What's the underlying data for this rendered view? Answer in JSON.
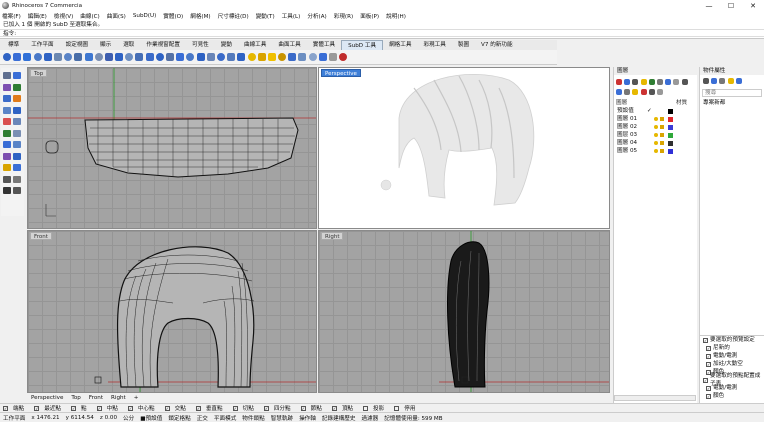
{
  "window": {
    "title": "Rhinoceros 7 Commercia",
    "buttons": [
      "—",
      "☐",
      "✕"
    ]
  },
  "menu": [
    "檔案(F)",
    "編輯(E)",
    "檢視(V)",
    "曲線(C)",
    "曲面(S)",
    "SubD(U)",
    "實體(O)",
    "網格(M)",
    "尺寸標註(D)",
    "變動(T)",
    "工具(L)",
    "分析(A)",
    "彩現(R)",
    "面板(P)",
    "說明(H)"
  ],
  "command": {
    "history1": "已加入 1 個 開啟的 SubD 至選取集合。",
    "history2": "指令:",
    "prompt": ""
  },
  "tabs": [
    "標準",
    "工作平面",
    "設定視圖",
    "顯示",
    "選取",
    "作業視窗配置",
    "可見性",
    "變動",
    "曲線工具",
    "曲面工具",
    "實體工具",
    "SubD 工具",
    "網格工具",
    "彩現工具",
    "製圖",
    "V7 的新功能"
  ],
  "active_tab_index": 11,
  "toolbar_icons": [
    "#2f63c4",
    "#3a6ed6",
    "#3171d8",
    "#4a79c8",
    "#2f63c4",
    "#6d89b2",
    "#5a84c7",
    "#4a6ea8",
    "#3f78d1",
    "#7a8fb3",
    "#3f5fb0",
    "#2f63c4",
    "#6d8fc2",
    "#476fb6",
    "#3b6bc9",
    "#2f63c4",
    "#5672a6",
    "#3a6ed6",
    "#4a79c8",
    "#2f63c4",
    "#6a86b8",
    "#3b6bc9",
    "#557bbd",
    "#2f63c4",
    "#e6b800",
    "#d9a400",
    "#f0c000",
    "#c99400",
    "#3b6bc9",
    "#6d8fc2",
    "#8aa4cc",
    "#3a6ed6",
    "#9a9a9a",
    "#c02b2b"
  ],
  "left_icons": [
    "#5f6f8f",
    "#3a6ed6",
    "#7d4fb0",
    "#2f7d32",
    "#3b6bc9",
    "#e07b1a",
    "#5a84c7",
    "#2f63c4",
    "#d94f4f",
    "#6a86b8",
    "#2f7d32",
    "#7a8fb3",
    "#3a6ed6",
    "#5a84c7",
    "#7d4fb0",
    "#2f63c4",
    "#d9a400",
    "#3a6ed6",
    "#555555",
    "#777777",
    "#333333",
    "#555555"
  ],
  "viewports": {
    "top": "Top",
    "perspective": "Perspective",
    "front": "Front",
    "right": "Right"
  },
  "viewport_tabs": [
    "Perspective",
    "Top",
    "Front",
    "Right"
  ],
  "layers": {
    "panel_title": "圖層",
    "col_name": "圖層",
    "col_material": "材質",
    "rows": [
      {
        "name": "預設值",
        "current": true,
        "color": "#000000"
      },
      {
        "name": "圖層 01",
        "color": "#e0262b"
      },
      {
        "name": "圖層 02",
        "color": "#3b3bd6"
      },
      {
        "name": "圖层 03",
        "color": "#2fa83a"
      },
      {
        "name": "圖層 04",
        "color": "#2f2f2f"
      },
      {
        "name": "圖層 05",
        "color": "#2f2fd6"
      }
    ]
  },
  "properties": {
    "panel_title": "物件屬性",
    "search_placeholder": "搜尋",
    "item": "專案新都",
    "section1": "要選取的預覽設定",
    "section1_items": [
      "尼新的",
      "電動/電測",
      "加註/大動空",
      "顏色"
    ],
    "section2": "要選取的預點配置成子表",
    "section2_items": [
      "電動/電測",
      "顏色"
    ]
  },
  "snaps": [
    "端點",
    "最近點",
    "點",
    "中點",
    "中心點",
    "交點",
    "垂直點",
    "切點",
    "四分點",
    "節點",
    "頂點",
    "投影",
    "停用"
  ],
  "status": [
    "工作平面",
    "x 1476.21",
    "y 6114.54",
    "z 0.00",
    "公分",
    "■預設值",
    "鎖定格點",
    "正交",
    "平面模式",
    "物件鎖點",
    "智慧軌跡",
    "操作軸",
    "記錄建構歷史",
    "過濾器",
    "記憶體使用量: 599 MB"
  ]
}
